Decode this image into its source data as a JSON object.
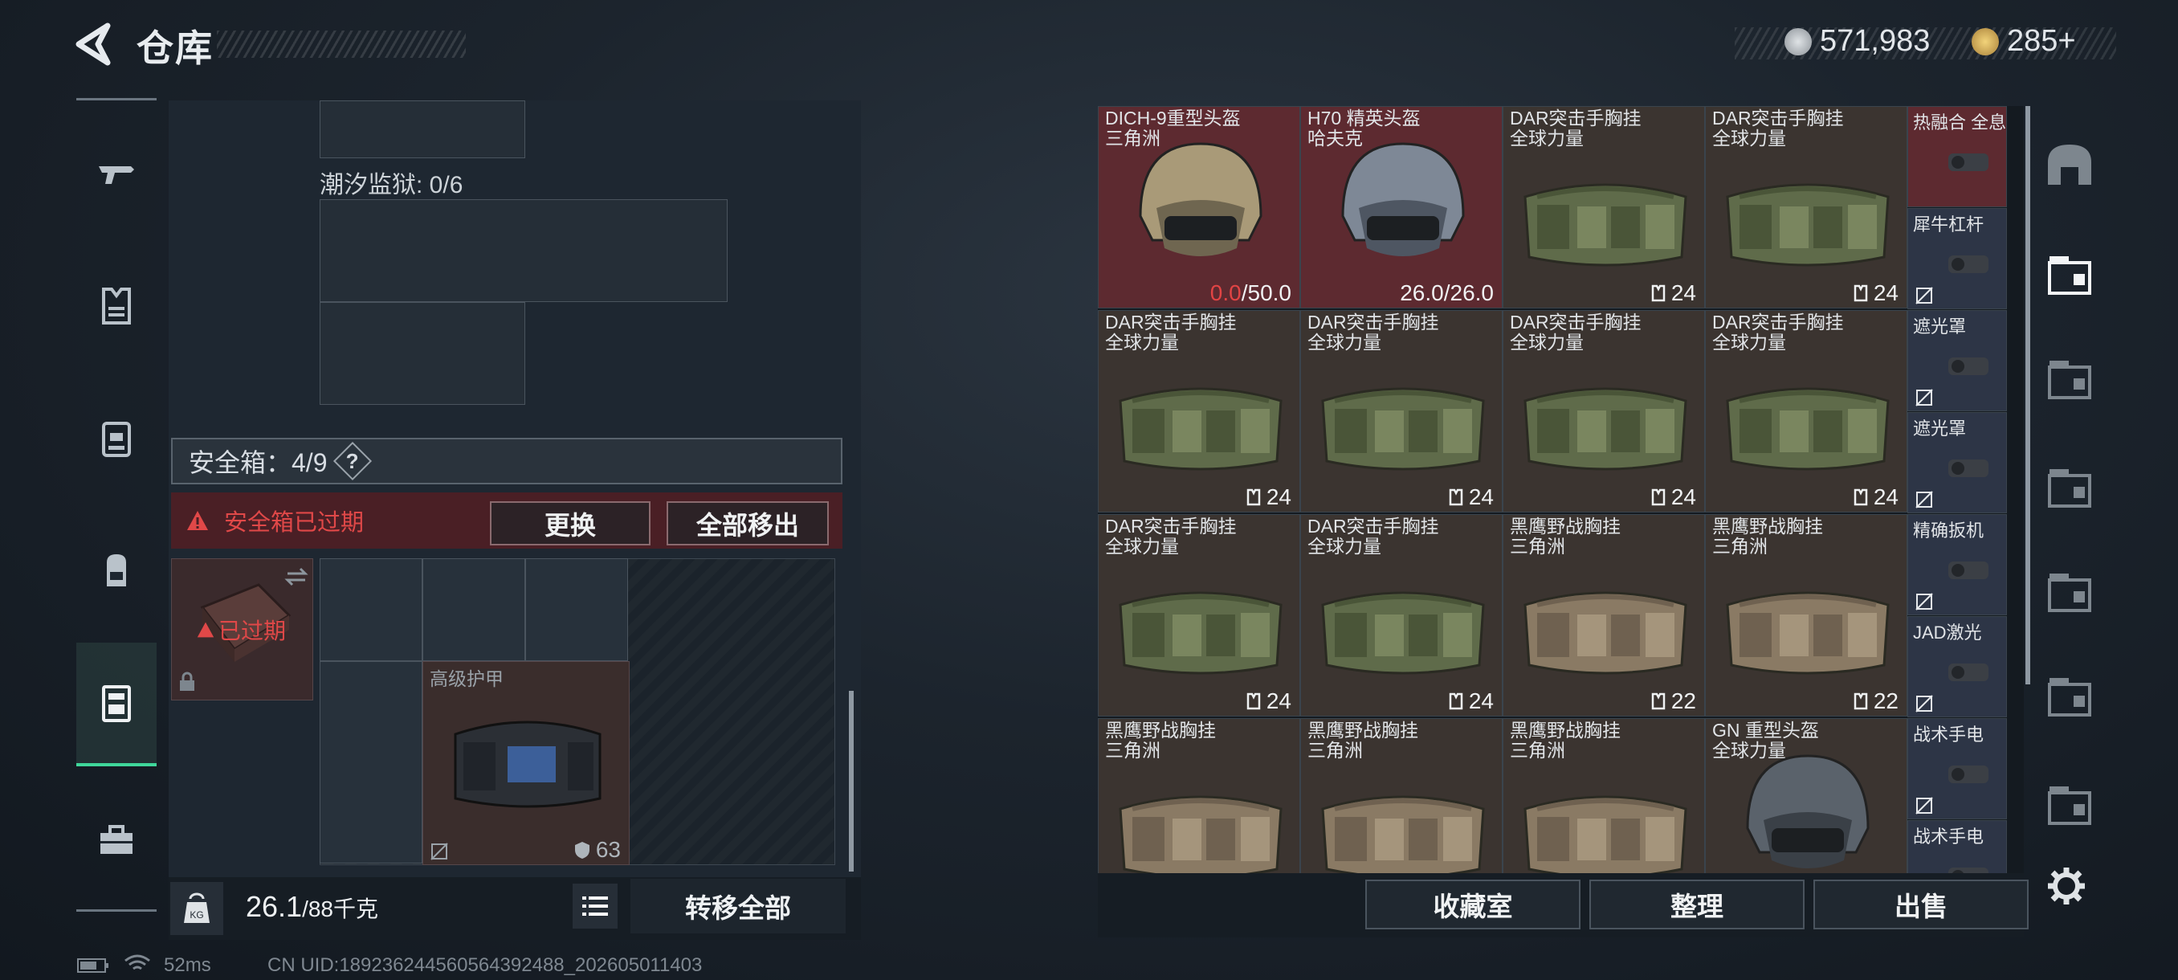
{
  "header": {
    "title": "仓库"
  },
  "currency": {
    "coins": "571,983",
    "gems": "285+"
  },
  "left_nav": [
    "weapon-icon",
    "armor-vest-icon",
    "rig-icon",
    "backpack-icon",
    "safe-box-icon",
    "toolbox-icon"
  ],
  "storage": {
    "prison_label": "潮汐监狱: 0/6",
    "safebox_label": "安全箱：4/9",
    "qmark": "?",
    "expired_warning": "安全箱已过期",
    "replace_btn": "更换",
    "remove_all_btn": "全部移出",
    "expired_tag": "已过期",
    "armor_item": {
      "name": "高级护甲",
      "durability": "63"
    }
  },
  "weight": {
    "current": "26.1",
    "max": "/88千克"
  },
  "transfer_all_btn": "转移全部",
  "items": [
    {
      "name": "DICH-9重型头盔",
      "sub": "三角洲",
      "qty_a": "0.0",
      "qty_b": "/50.0",
      "type": "helmet-tan",
      "bg": "red"
    },
    {
      "name": "H70 精英头盔",
      "sub": "哈夫克",
      "qty_a": "",
      "qty_b": "26.0/26.0",
      "type": "helmet-grey",
      "bg": "red"
    },
    {
      "name": "DAR突击手胸挂",
      "sub": "全球力量",
      "qty_a": "",
      "qty_b": "24",
      "type": "rig-green",
      "bg": "brown"
    },
    {
      "name": "DAR突击手胸挂",
      "sub": "全球力量",
      "qty_a": "",
      "qty_b": "24",
      "type": "rig-green",
      "bg": "brown"
    },
    {
      "name": "DAR突击手胸挂",
      "sub": "全球力量",
      "qty_a": "",
      "qty_b": "24",
      "type": "rig-green",
      "bg": "brown"
    },
    {
      "name": "DAR突击手胸挂",
      "sub": "全球力量",
      "qty_a": "",
      "qty_b": "24",
      "type": "rig-green",
      "bg": "brown"
    },
    {
      "name": "DAR突击手胸挂",
      "sub": "全球力量",
      "qty_a": "",
      "qty_b": "24",
      "type": "rig-green",
      "bg": "brown"
    },
    {
      "name": "DAR突击手胸挂",
      "sub": "全球力量",
      "qty_a": "",
      "qty_b": "24",
      "type": "rig-green",
      "bg": "brown"
    },
    {
      "name": "DAR突击手胸挂",
      "sub": "全球力量",
      "qty_a": "",
      "qty_b": "24",
      "type": "rig-green",
      "bg": "brown"
    },
    {
      "name": "DAR突击手胸挂",
      "sub": "全球力量",
      "qty_a": "",
      "qty_b": "24",
      "type": "rig-green",
      "bg": "brown"
    },
    {
      "name": "黑鹰野战胸挂",
      "sub": "三角洲",
      "qty_a": "",
      "qty_b": "22",
      "type": "rig-tan",
      "bg": "brown"
    },
    {
      "name": "黑鹰野战胸挂",
      "sub": "三角洲",
      "qty_a": "",
      "qty_b": "22",
      "type": "rig-tan",
      "bg": "brown"
    },
    {
      "name": "黑鹰野战胸挂",
      "sub": "三角洲",
      "qty_a": "",
      "qty_b": "",
      "type": "rig-tan",
      "bg": "brown"
    },
    {
      "name": "黑鹰野战胸挂",
      "sub": "三角洲",
      "qty_a": "",
      "qty_b": "",
      "type": "rig-tan",
      "bg": "brown"
    },
    {
      "name": "黑鹰野战胸挂",
      "sub": "三角洲",
      "qty_a": "",
      "qty_b": "",
      "type": "rig-tan",
      "bg": "brown"
    },
    {
      "name": "GN 重型头盔",
      "sub": "全球力量",
      "qty_a": "",
      "qty_b": "",
      "type": "helmet-dark",
      "bg": "brown"
    }
  ],
  "side_items": [
    {
      "name": "热融合 全息",
      "bg": "red"
    },
    {
      "name": "犀牛杠杆",
      "bg": "blue"
    },
    {
      "name": "遮光罩",
      "bg": "blue"
    },
    {
      "name": "遮光罩",
      "bg": "blue"
    },
    {
      "name": "精确扳机",
      "bg": "blue"
    },
    {
      "name": "JAD激光",
      "bg": "blue"
    },
    {
      "name": "战术手电",
      "bg": "blue"
    },
    {
      "name": "战术手电",
      "bg": "blue"
    }
  ],
  "right_nav": [
    "helmet-slot-icon",
    "gti-box-icon",
    "gti-scope-icon",
    "gti-rail-icon",
    "iv-plus-icon",
    "iv-folder-icon",
    "v-case-icon"
  ],
  "right_buttons": {
    "collection": "收藏室",
    "sort": "整理",
    "sell": "出售"
  },
  "status": {
    "ping": "52ms",
    "uid": "CN UID:18923624456056439248​8_202605011403"
  }
}
